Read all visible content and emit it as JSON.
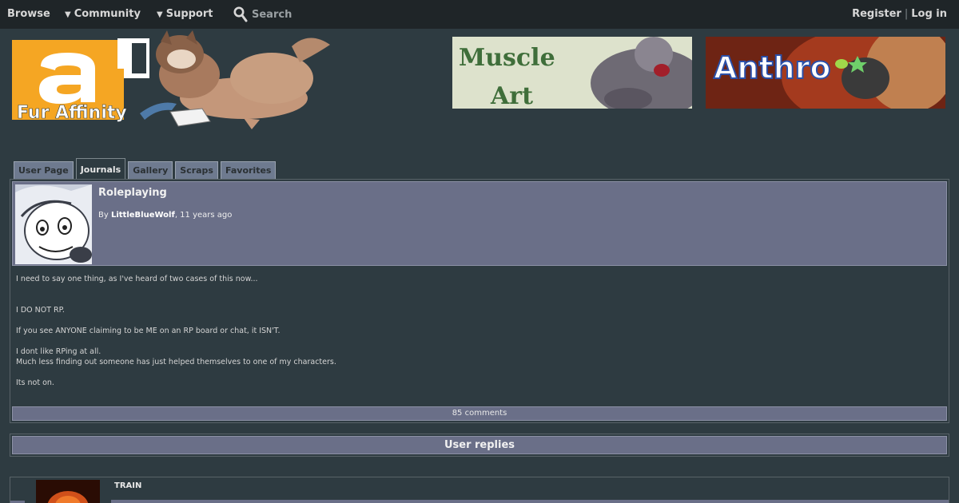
{
  "nav": {
    "browse": "Browse",
    "community": "Community",
    "support": "Support",
    "search": "Search",
    "register": "Register",
    "separator": "|",
    "login": "Log in"
  },
  "logo": {
    "text": "Fur Affinity",
    "glyph": "a"
  },
  "banners": {
    "muscle": {
      "line1": "Muscle",
      "line2": "Art"
    },
    "anthro": {
      "text": "Anthro"
    }
  },
  "tabs": [
    {
      "label": "User Page",
      "active": false
    },
    {
      "label": "Journals",
      "active": true
    },
    {
      "label": "Gallery",
      "active": false
    },
    {
      "label": "Scraps",
      "active": false
    },
    {
      "label": "Favorites",
      "active": false
    }
  ],
  "journal": {
    "title": "Roleplaying",
    "by_prefix": "By",
    "author": "LittleBlueWolf",
    "age": ", 11 years ago",
    "body": [
      "I need to say one thing, as I've heard of two cases of this now...",
      "",
      "",
      "I DO NOT RP.",
      "",
      "If you see ANYONE claiming to be ME on an RP board or chat, it ISN'T.",
      "",
      "I dont like RPing at all.",
      "Much less finding out someone has just helped themselves to one of my characters.",
      "",
      "Its not on."
    ],
    "comments": "85 comments"
  },
  "replies": {
    "heading": "User replies",
    "first_name": "TRAIN"
  },
  "colors": {
    "page_bg": "#2e3b41",
    "nav_bg": "#1f2528",
    "header_panel": "#6a6f88",
    "tab_bg": "#6e7a8f",
    "logo_orange": "#f5a623"
  },
  "icons": {
    "search": "magnifier-icon",
    "dropdown": "triangle-down-icon"
  }
}
